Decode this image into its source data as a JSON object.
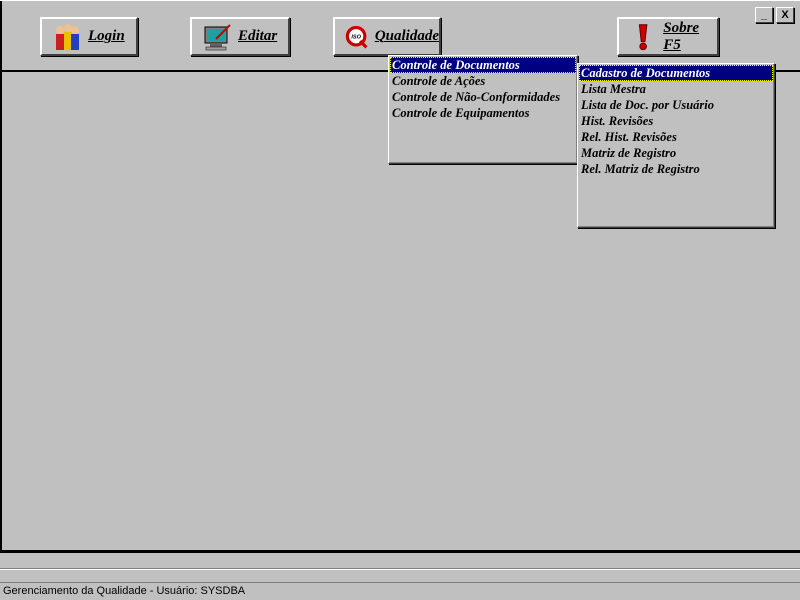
{
  "toolbar": {
    "buttons": [
      {
        "label": "Login",
        "icon": "users-icon"
      },
      {
        "label": "Editar",
        "icon": "monitor-edit-icon"
      },
      {
        "label": "Qualidade",
        "icon": "iso-q-icon"
      },
      {
        "label": "Sobre F5",
        "icon": "exclamation-icon"
      }
    ]
  },
  "window_controls": {
    "minimize": "_",
    "close": "X"
  },
  "quality_menu": {
    "items": [
      "Controle de Documentos",
      "Controle de Ações",
      "Controle de Não-Conformidades",
      "Controle de Equipamentos"
    ],
    "selected": 0
  },
  "documents_submenu": {
    "items": [
      "Cadastro de Documentos",
      "Lista Mestra",
      "Lista de Doc. por Usuário",
      "Hist. Revisões",
      "Rel. Hist. Revisões",
      "Matriz de Registro",
      "Rel. Matriz de Registro"
    ],
    "selected": 0
  },
  "status": {
    "text": "Gerenciamento da Qualidade - Usuário: SYSDBA"
  },
  "colors": {
    "face": "#c0c0c0",
    "highlight": "#000080",
    "accent_red": "#cc0000"
  }
}
